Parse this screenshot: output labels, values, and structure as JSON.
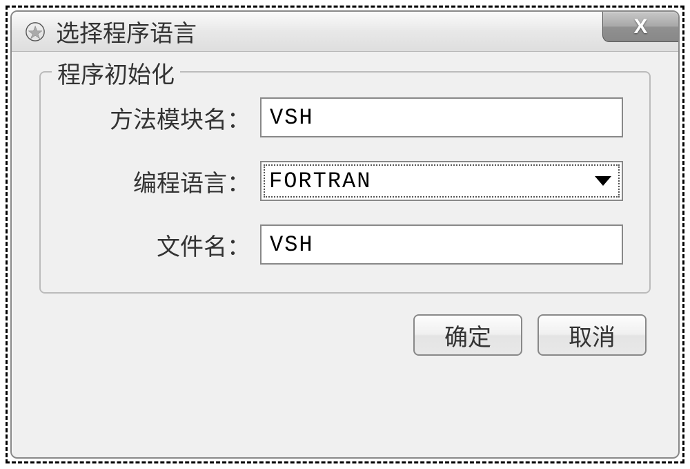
{
  "dialog": {
    "title": "选择程序语言",
    "groupbox_legend": "程序初始化",
    "fields": {
      "method_module": {
        "label": "方法模块名：",
        "value": "VSH"
      },
      "programming_language": {
        "label": "编程语言：",
        "selected": "FORTRAN"
      },
      "file_name": {
        "label": "文件名：",
        "value": "VSH"
      }
    },
    "buttons": {
      "ok": "确定",
      "cancel": "取消"
    }
  }
}
